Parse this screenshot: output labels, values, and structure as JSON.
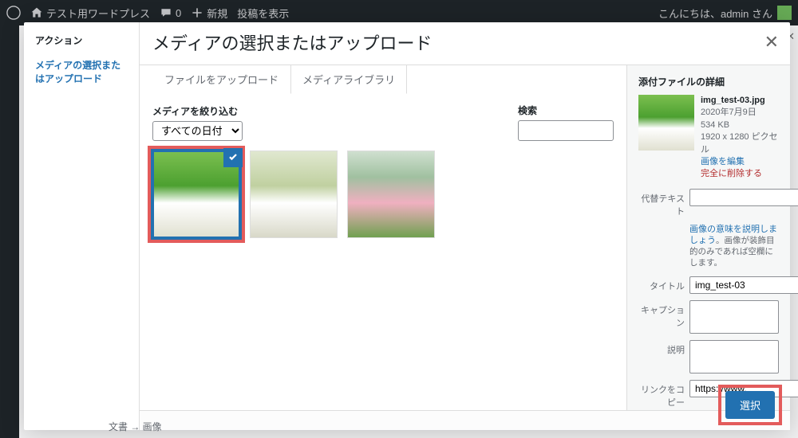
{
  "adminbar": {
    "site": "テスト用ワードプレス",
    "comments": "0",
    "new": "新規",
    "view_post": "投稿を表示",
    "greeting": "こんにちは、admin さん"
  },
  "modal": {
    "sidebar_action_heading": "アクション",
    "sidebar_nav": "メディアの選択またはアップロード",
    "title": "メディアの選択またはアップロード",
    "tab_upload": "ファイルをアップロード",
    "tab_library": "メディアライブラリ",
    "filter_label": "メディアを絞り込む",
    "filter_option": "すべての日付",
    "search_label": "検索",
    "details": {
      "heading": "添付ファイルの詳細",
      "filename": "img_test-03.jpg",
      "date": "2020年7月9日",
      "filesize": "534 KB",
      "dimensions": "1920 x 1280 ピクセル",
      "edit_image": "画像を編集",
      "delete": "完全に削除する",
      "alt_label": "代替テキスト",
      "alt_value": "",
      "alt_help_link": "画像の意味を説明しましょう",
      "alt_help_tail": "。画像が装飾目的のみであれば空欄にします。",
      "title_label": "タイトル",
      "title_value": "img_test-03",
      "caption_label": "キャプション",
      "caption_value": "",
      "description_label": "説明",
      "description_value": "",
      "copy_link_label": "リンクをコピー",
      "copy_link_value": "https://www."
    },
    "select_btn": "選択"
  },
  "breadcrumb": "文書 → 画像"
}
